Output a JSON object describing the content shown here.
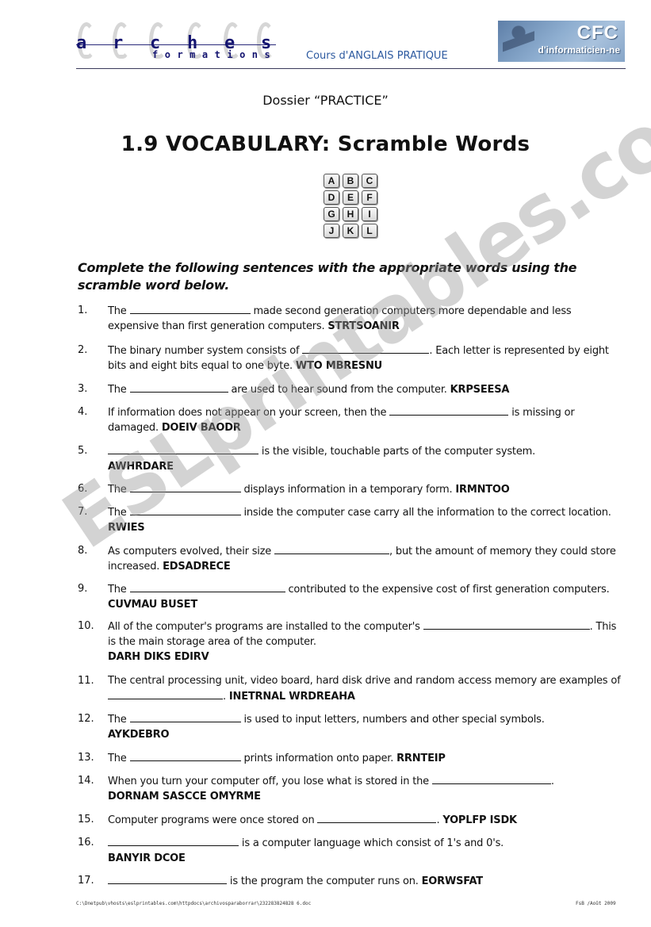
{
  "header": {
    "logo_left": {
      "letters": [
        "a",
        "r",
        "c",
        "h",
        "e",
        "s"
      ],
      "subtitle": "formations"
    },
    "course_title": "Cours d'ANGLAIS PRATIQUE",
    "logo_right": {
      "big": "CFC",
      "small": "d'informaticien-ne"
    }
  },
  "dossier": "Dossier “PRACTICE”",
  "title": "1.9  VOCABULARY: Scramble Words",
  "tiles": [
    "A",
    "B",
    "C",
    "D",
    "E",
    "F",
    "G",
    "H",
    "I",
    "J",
    "K",
    "L"
  ],
  "instruction": "Complete the following sentences with the appropriate words using the scramble word below.",
  "items": [
    {
      "num": "1.",
      "parts": [
        "The ",
        "__",
        " made second generation computers more dependable and less expensive than first generation computers. "
      ],
      "scramble": "STRTSOANIR"
    },
    {
      "num": "2.",
      "parts": [
        "The binary number system consists of ",
        "__",
        ". Each letter is represented by eight bits and eight bits equal to one byte. "
      ],
      "scramble": "WTO MBRESNU"
    },
    {
      "num": "3.",
      "parts": [
        "The ",
        "__",
        " are used to hear sound from the computer. "
      ],
      "scramble": "KRPSEESA"
    },
    {
      "num": "4.",
      "parts": [
        "If information does not appear on your screen, then the ",
        "__",
        " is missing or damaged. "
      ],
      "scramble": "DOEIV BAODR"
    },
    {
      "num": "5.",
      "parts": [
        "",
        "__",
        " is the visible, touchable parts of the computer system. "
      ],
      "scramble": "AWHRDARE"
    },
    {
      "num": "6.",
      "parts": [
        "The ",
        "__",
        " displays information in a temporary form.  "
      ],
      "scramble": "IRMNTOO"
    },
    {
      "num": "7.",
      "parts": [
        "The ",
        "__",
        " inside the computer case carry all the information to the correct location. "
      ],
      "scramble": "RWIES"
    },
    {
      "num": "8.",
      "parts": [
        "As computers evolved, their size ",
        "__",
        ", but the amount of memory they could store increased. "
      ],
      "scramble": "EDSADRECE"
    },
    {
      "num": "9.",
      "parts": [
        "The ",
        "__",
        " contributed to the expensive cost of first generation computers. "
      ],
      "scramble": "CUVMAU BUSET"
    },
    {
      "num": "10.",
      "parts": [
        "All of the computer's programs are installed to the computer's ",
        "__",
        ". This is the main storage area of the computer. "
      ],
      "scramble": "DARH DIKS EDIRV"
    },
    {
      "num": "11.",
      "parts": [
        "The central processing unit, video board, hard disk drive and random access memory are examples of ",
        "__",
        ". "
      ],
      "scramble": "INETRNAL WRDREAHA"
    },
    {
      "num": "12.",
      "parts": [
        "The ",
        "__",
        " is used to input letters, numbers and other special symbols. "
      ],
      "scramble": "AYKDEBRO"
    },
    {
      "num": "13.",
      "parts": [
        "The ",
        "__",
        " prints information onto paper. "
      ],
      "scramble": "RRNTEIP"
    },
    {
      "num": "14.",
      "parts": [
        "When you turn your computer off, you lose what is stored in the ",
        "__",
        ". "
      ],
      "scramble": "DORNAM SASCCE OMYRME"
    },
    {
      "num": "15.",
      "parts": [
        "Computer programs were once stored on ",
        "__",
        ". "
      ],
      "scramble": "YOPLFP ISDK"
    },
    {
      "num": "16.",
      "parts": [
        "",
        "__",
        " is a computer language which consist of 1's and 0's. "
      ],
      "scramble": "BANYIR DCOE"
    },
    {
      "num": "17.",
      "parts": [
        "",
        "__",
        " is the program the computer runs on. "
      ],
      "scramble": "EORWSFAT"
    }
  ],
  "watermark": "ESLprintables.com",
  "footer": {
    "path": "C:\\Dnetpub\\vhosts\\eslprintables.com\\httpdocs\\archivosparaborrar\\232283824828 6.doc",
    "right": "FsB /Août 2009"
  }
}
